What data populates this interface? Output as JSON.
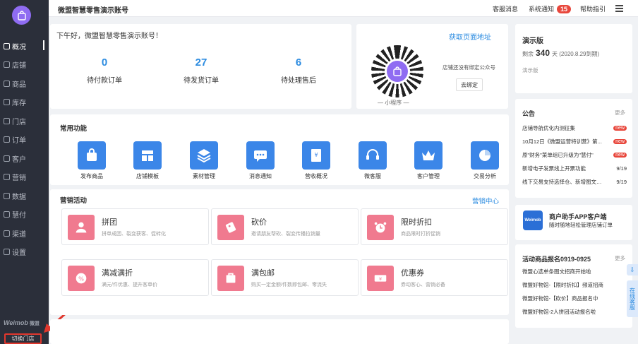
{
  "sidebar": {
    "items": [
      {
        "label": "概况",
        "active": true
      },
      {
        "label": "店铺"
      },
      {
        "label": "商品"
      },
      {
        "label": "库存"
      },
      {
        "label": "门店"
      },
      {
        "label": "订单"
      },
      {
        "label": "客户"
      },
      {
        "label": "营销"
      },
      {
        "label": "数据"
      },
      {
        "label": "慧付"
      },
      {
        "label": "渠道"
      },
      {
        "label": "设置"
      }
    ],
    "brand": "Weimob",
    "brand_cn": "微盟",
    "switch_store": "切换门店"
  },
  "topbar": {
    "account": "微盟智慧零售演示账号",
    "service_msg": "客服消息",
    "sys_notice": "系统通知",
    "sys_notice_count": "15",
    "help": "帮助指引"
  },
  "greeting": {
    "text": "下午好，微盟智慧零售演示账号！",
    "stats": [
      {
        "num": "0",
        "label": "待付款订单"
      },
      {
        "num": "27",
        "label": "待发货订单"
      },
      {
        "num": "6",
        "label": "待处理售后"
      }
    ]
  },
  "qr": {
    "link": "获取页面地址",
    "caption": "— 小程序 —",
    "note": "店铺还没有绑定公众号",
    "bind_btn": "去绑定"
  },
  "functions": {
    "title": "常用功能",
    "items": [
      {
        "label": "发布商品",
        "icon": "shopping-bag-icon",
        "color": "#3b86e8"
      },
      {
        "label": "店铺模板",
        "icon": "template-icon",
        "color": "#3b86e8"
      },
      {
        "label": "素材管理",
        "icon": "layers-icon",
        "color": "#3b86e8"
      },
      {
        "label": "消息通知",
        "icon": "message-icon",
        "color": "#3b86e8"
      },
      {
        "label": "营收概况",
        "icon": "revenue-icon",
        "color": "#3b86e8"
      },
      {
        "label": "微客服",
        "icon": "headset-icon",
        "color": "#3b86e8"
      },
      {
        "label": "客户管理",
        "icon": "crown-icon",
        "color": "#3b86e8"
      },
      {
        "label": "交易分析",
        "icon": "pie-chart-icon",
        "color": "#3b86e8"
      }
    ]
  },
  "marketing": {
    "title": "营销活动",
    "center_link": "营销中心",
    "items": [
      {
        "title": "拼团",
        "desc": "拼单成团、裂变获客、促转化",
        "icon": "group-icon"
      },
      {
        "title": "砍价",
        "desc": "邀请朋友帮砍、裂变传播拉销量",
        "icon": "bargain-icon"
      },
      {
        "title": "限时折扣",
        "desc": "商品限时打折促销",
        "icon": "alarm-clock-icon"
      },
      {
        "title": "满减满折",
        "desc": "满元/件优惠、提升客单价",
        "icon": "discount-icon"
      },
      {
        "title": "满包邮",
        "desc": "购买一定金额/件数即包邮、零流失",
        "icon": "package-icon"
      },
      {
        "title": "优惠券",
        "desc": "券动客心、营销必备",
        "icon": "coupon-icon"
      }
    ],
    "accent": "#f07a8f"
  },
  "demo": {
    "title": "演示版",
    "remain_prefix": "剩余",
    "remain_days": "340",
    "remain_suffix": "天  (2020.8.29到期)",
    "sub": "演示版"
  },
  "notice": {
    "title": "公告",
    "more": "更多",
    "items": [
      {
        "text": "店铺导航优化内测征集",
        "tag": "new"
      },
      {
        "text": "10月12日《微盟运营特训营》第...",
        "tag": "new"
      },
      {
        "text": "原\"财务\"菜单组已升级为\"慧付\"",
        "tag": "new"
      },
      {
        "text": "新增电子发票线上开票功能",
        "date": "9/19"
      },
      {
        "text": "线下交易支持选择仓、新增图文列...",
        "date": "9/19"
      }
    ]
  },
  "app_promo": {
    "logo": "Weimob",
    "title": "商户助手APP客户端",
    "sub": "随时随地轻松管理店铺订单"
  },
  "activity": {
    "title": "活动商品报名0919-0925",
    "more": "更多",
    "items": [
      "微盟心选单条图文招商开始啦",
      "微盟好物馆-【限时折扣】频道招商",
      "微盟好物馆-【砍价】商品报名中",
      "微盟好物馆-2人拼团活动报名啦"
    ]
  },
  "floating": {
    "service": "在线客服"
  }
}
